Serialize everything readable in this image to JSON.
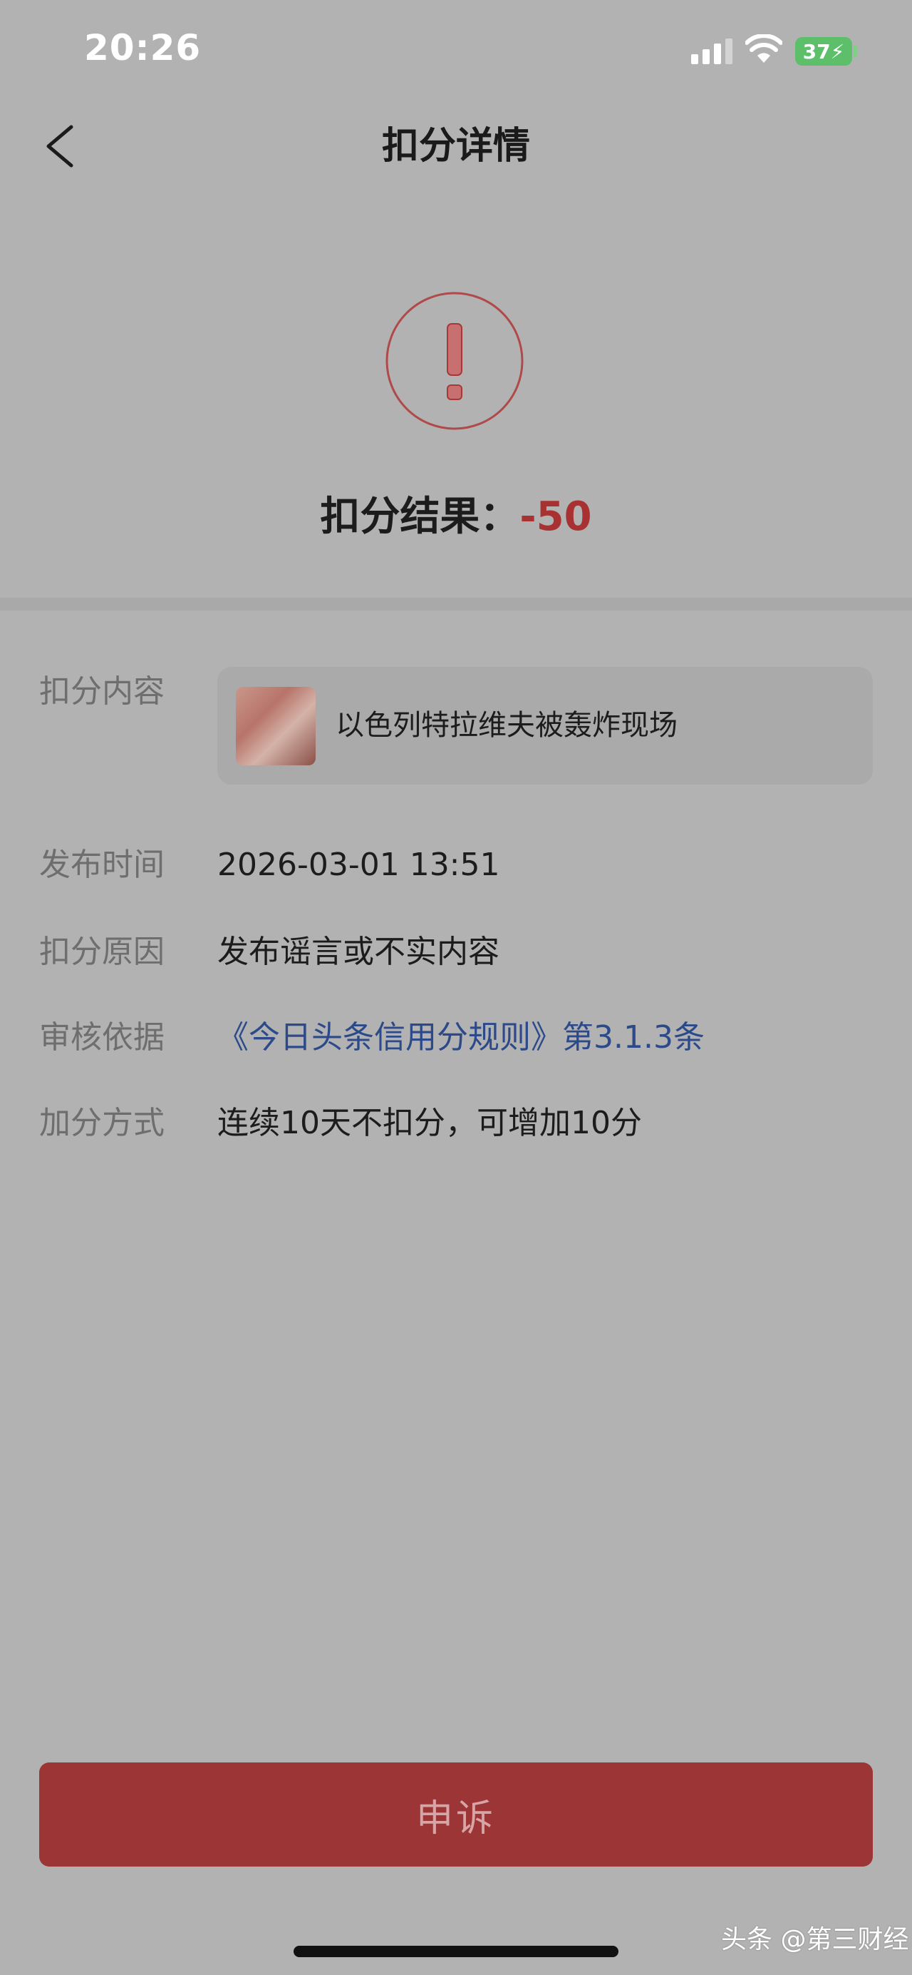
{
  "status_bar": {
    "time": "20:26",
    "battery": "37"
  },
  "nav": {
    "back_icon": "chevron-left-icon",
    "title": "扣分详情"
  },
  "result": {
    "icon": "exclamation-circle-icon",
    "label": "扣分结果：",
    "value": "-50",
    "value_color": "#a83232"
  },
  "details": {
    "content": {
      "label": "扣分内容",
      "title": "以色列特拉维夫被轰炸现场"
    },
    "publish_time": {
      "label": "发布时间",
      "value": "2026-03-01 13:51"
    },
    "reason": {
      "label": "扣分原因",
      "value": "发布谣言或不实内容"
    },
    "basis": {
      "label": "审核依据",
      "value": "《今日头条信用分规则》第3.1.3条",
      "color": "#2c4a8a"
    },
    "bonus": {
      "label": "加分方式",
      "value": "连续10天不扣分，可增加10分"
    }
  },
  "appeal_button": {
    "label": "申诉",
    "color": "#9c3535"
  },
  "watermark": "头条 @第三财经"
}
